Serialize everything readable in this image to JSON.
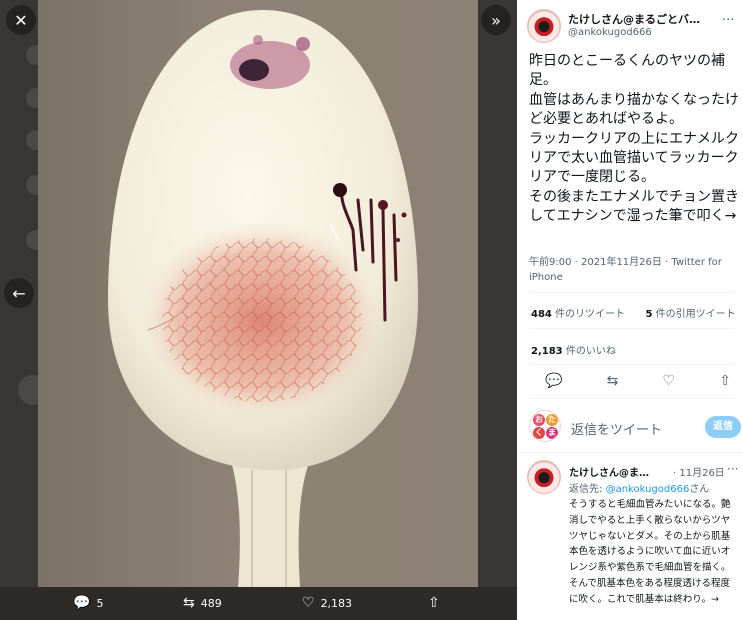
{
  "viewer": {
    "close_icon": "close-icon",
    "expand_icon": "chevron-double-right-icon",
    "prev_icon": "arrow-left-icon",
    "actions": {
      "reply_count": "5",
      "retweet_count": "489",
      "like_count": "2,183"
    }
  },
  "tweet": {
    "author_name": "たけしさん@まるごとバナナ",
    "author_handle": "@ankokugod666",
    "text": "昨日のとこーるくんのヤツの補足。\n血管はあんまり描かなくなったけど必要とあればやるよ。\nラッカークリアの上にエナメルクリアで太い血管描いてラッカークリアで一度閉じる。\nその後またエナメルでチョン置きしてエナシンで湿った筆で叩く→",
    "timestamp": "午前9:00 · 2021年11月26日 · Twitter for iPhone",
    "retweets": "484",
    "retweets_label": " 件のリツイート",
    "quotes": "5",
    "quotes_label": " 件の引用ツイート",
    "likes": "2,183",
    "likes_label": " 件のいいね"
  },
  "compose": {
    "placeholder": "返信をツイート",
    "avatar_letters": [
      "お",
      "た",
      "く",
      "ま"
    ],
    "reply_button": "返信"
  },
  "reply": {
    "author_name": "たけしさん@ま…",
    "date": "· 11月26日",
    "replying_prefix": "返信先: ",
    "replying_handle": "@ankokugod666",
    "replying_suffix": "さん",
    "text": "そうすると毛細血管みたいになる。艶消しでやると上手く散らないからツヤツヤじゃないとダメ。その上から肌基本色を透けるように吹いて血に近いオレンジ系や紫色系で毛細血管を描く。そんで肌基本色をある程度透ける程度に吹く。これで肌基本は終わり。→"
  },
  "colors": {
    "link": "#1d9bf0",
    "reply_button": "#8ecdf8",
    "viewer_bg": "#2d2a27"
  }
}
